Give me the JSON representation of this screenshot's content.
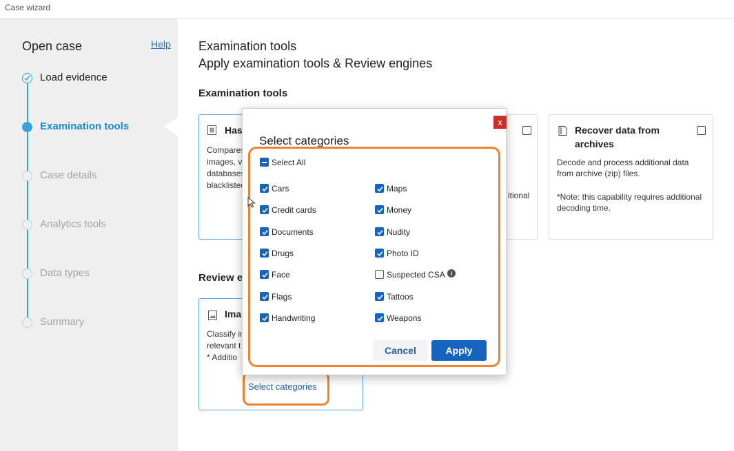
{
  "window": {
    "title": "Case wizard"
  },
  "sidebar": {
    "heading": "Open case",
    "help": "Help",
    "steps": [
      {
        "label": "Load evidence",
        "state": "done"
      },
      {
        "label": "Examination tools",
        "state": "active"
      },
      {
        "label": "Case details",
        "state": "future"
      },
      {
        "label": "Analytics tools",
        "state": "future"
      },
      {
        "label": "Data types",
        "state": "future"
      },
      {
        "label": "Summary",
        "state": "future"
      }
    ]
  },
  "main": {
    "title": "Examination tools",
    "subtitle": "Apply examination tools & Review engines",
    "exam_section": "Examination tools",
    "review_section": "Review e",
    "cards": {
      "hash": {
        "title": "Has",
        "body": [
          "Compares",
          "images, vi",
          "databases",
          "blacklisted"
        ]
      },
      "middle": {
        "body_fragment": "itional"
      },
      "archives": {
        "title": "Recover data from archives",
        "body": "Decode and process additional data from archive (zip) files.",
        "note": "*Note: this capability requires additional decoding time."
      },
      "image": {
        "title": "Ima",
        "body": [
          "Classify in",
          "relevant t",
          "* Additio"
        ]
      }
    },
    "select_categories_link": "Select categories"
  },
  "dialog": {
    "title": "Select categories",
    "close": "x",
    "select_all": "Select All",
    "left_options": [
      {
        "label": "Cars",
        "checked": true
      },
      {
        "label": "Credit cards",
        "checked": true
      },
      {
        "label": "Documents",
        "checked": true
      },
      {
        "label": "Drugs",
        "checked": true
      },
      {
        "label": "Face",
        "checked": true
      },
      {
        "label": "Flags",
        "checked": true
      },
      {
        "label": "Handwriting",
        "checked": true
      }
    ],
    "right_options": [
      {
        "label": "Maps",
        "checked": true
      },
      {
        "label": "Money",
        "checked": true
      },
      {
        "label": "Nudity",
        "checked": true
      },
      {
        "label": "Photo ID",
        "checked": true
      },
      {
        "label": "Suspected CSA",
        "checked": false
      },
      {
        "label": "Tattoos",
        "checked": true
      },
      {
        "label": "Weapons",
        "checked": true
      }
    ],
    "cancel": "Cancel",
    "apply": "Apply"
  },
  "colors": {
    "accent": "#1565c0",
    "highlight": "#f0822f",
    "step": "#3aa2da",
    "close": "#c9302c"
  }
}
